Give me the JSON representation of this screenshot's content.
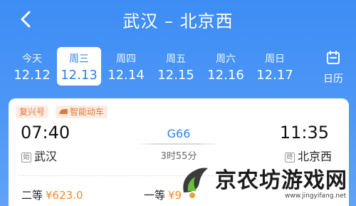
{
  "header": {
    "title": "武汉 – 北京西"
  },
  "dates": [
    {
      "dow": "今天",
      "date": "12.12",
      "active": false
    },
    {
      "dow": "周三",
      "date": "12.13",
      "active": true
    },
    {
      "dow": "周四",
      "date": "12.14",
      "active": false
    },
    {
      "dow": "周五",
      "date": "12.15",
      "active": false
    },
    {
      "dow": "周六",
      "date": "12.16",
      "active": false
    },
    {
      "dow": "周日",
      "date": "12.17",
      "active": false
    }
  ],
  "calendar": {
    "label": "日历",
    "icon": "calendar-icon"
  },
  "train": {
    "badges": [
      "复兴号",
      "智能动车"
    ],
    "depart_time": "07:40",
    "arrive_time": "11:35",
    "depart_tag": "始",
    "arrive_tag": "终",
    "depart_station": "武汉",
    "arrive_station": "北京西",
    "number": "G66",
    "duration": "3时55分",
    "seats": [
      {
        "name": "二等",
        "price": "¥623.0"
      },
      {
        "name": "一等",
        "price": "¥9"
      }
    ]
  },
  "watermark": {
    "text": "京农坊游戏网",
    "url": "www.jingyifang.net"
  },
  "colors": {
    "header_blue": "#3d8df5",
    "accent_blue": "#2f7ff0",
    "price_orange": "#f08a2b",
    "badge_orange": "#e07a3a"
  }
}
